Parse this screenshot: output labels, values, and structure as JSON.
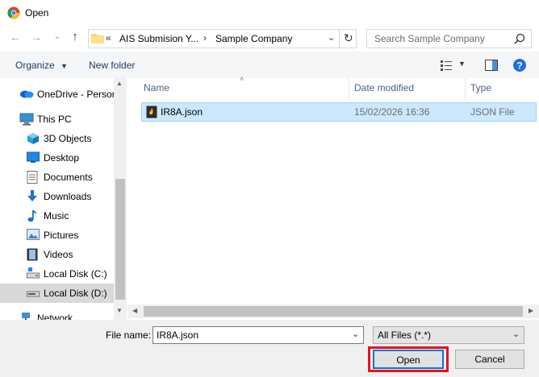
{
  "window": {
    "title": "Open"
  },
  "address": {
    "crumbs_prefix": "«",
    "crumb1": "AIS Submision Y...",
    "crumb2": "Sample Company"
  },
  "search": {
    "placeholder": "Search Sample Company"
  },
  "toolbar": {
    "organize": "Organize",
    "new_folder": "New folder"
  },
  "nav": {
    "items": [
      {
        "label": "OneDrive - Persor",
        "icon": "onedrive-icon"
      },
      {
        "label": "This PC",
        "icon": "computer-icon"
      },
      {
        "label": "3D Objects",
        "icon": "3d-objects-icon"
      },
      {
        "label": "Desktop",
        "icon": "desktop-icon"
      },
      {
        "label": "Documents",
        "icon": "documents-icon"
      },
      {
        "label": "Downloads",
        "icon": "downloads-icon"
      },
      {
        "label": "Music",
        "icon": "music-icon"
      },
      {
        "label": "Pictures",
        "icon": "pictures-icon"
      },
      {
        "label": "Videos",
        "icon": "videos-icon"
      },
      {
        "label": "Local Disk (C:)",
        "icon": "drive-c-icon"
      },
      {
        "label": "Local Disk (D:)",
        "icon": "drive-d-icon"
      },
      {
        "label": "Network",
        "icon": "network-icon"
      }
    ]
  },
  "list": {
    "columns": {
      "name": "Name",
      "date": "Date modified",
      "type": "Type"
    },
    "rows": [
      {
        "name": "IR8A.json",
        "date": "15/02/2026 16:36",
        "type": "JSON File"
      }
    ]
  },
  "footer": {
    "file_name_label": "File name:",
    "file_name_value": "IR8A.json",
    "filter_value": "All Files (*.*)",
    "open_label": "Open",
    "cancel_label": "Cancel"
  },
  "colors": {
    "accent": "#0078d7",
    "selection": "#cce8ff",
    "highlight": "#e81123"
  }
}
